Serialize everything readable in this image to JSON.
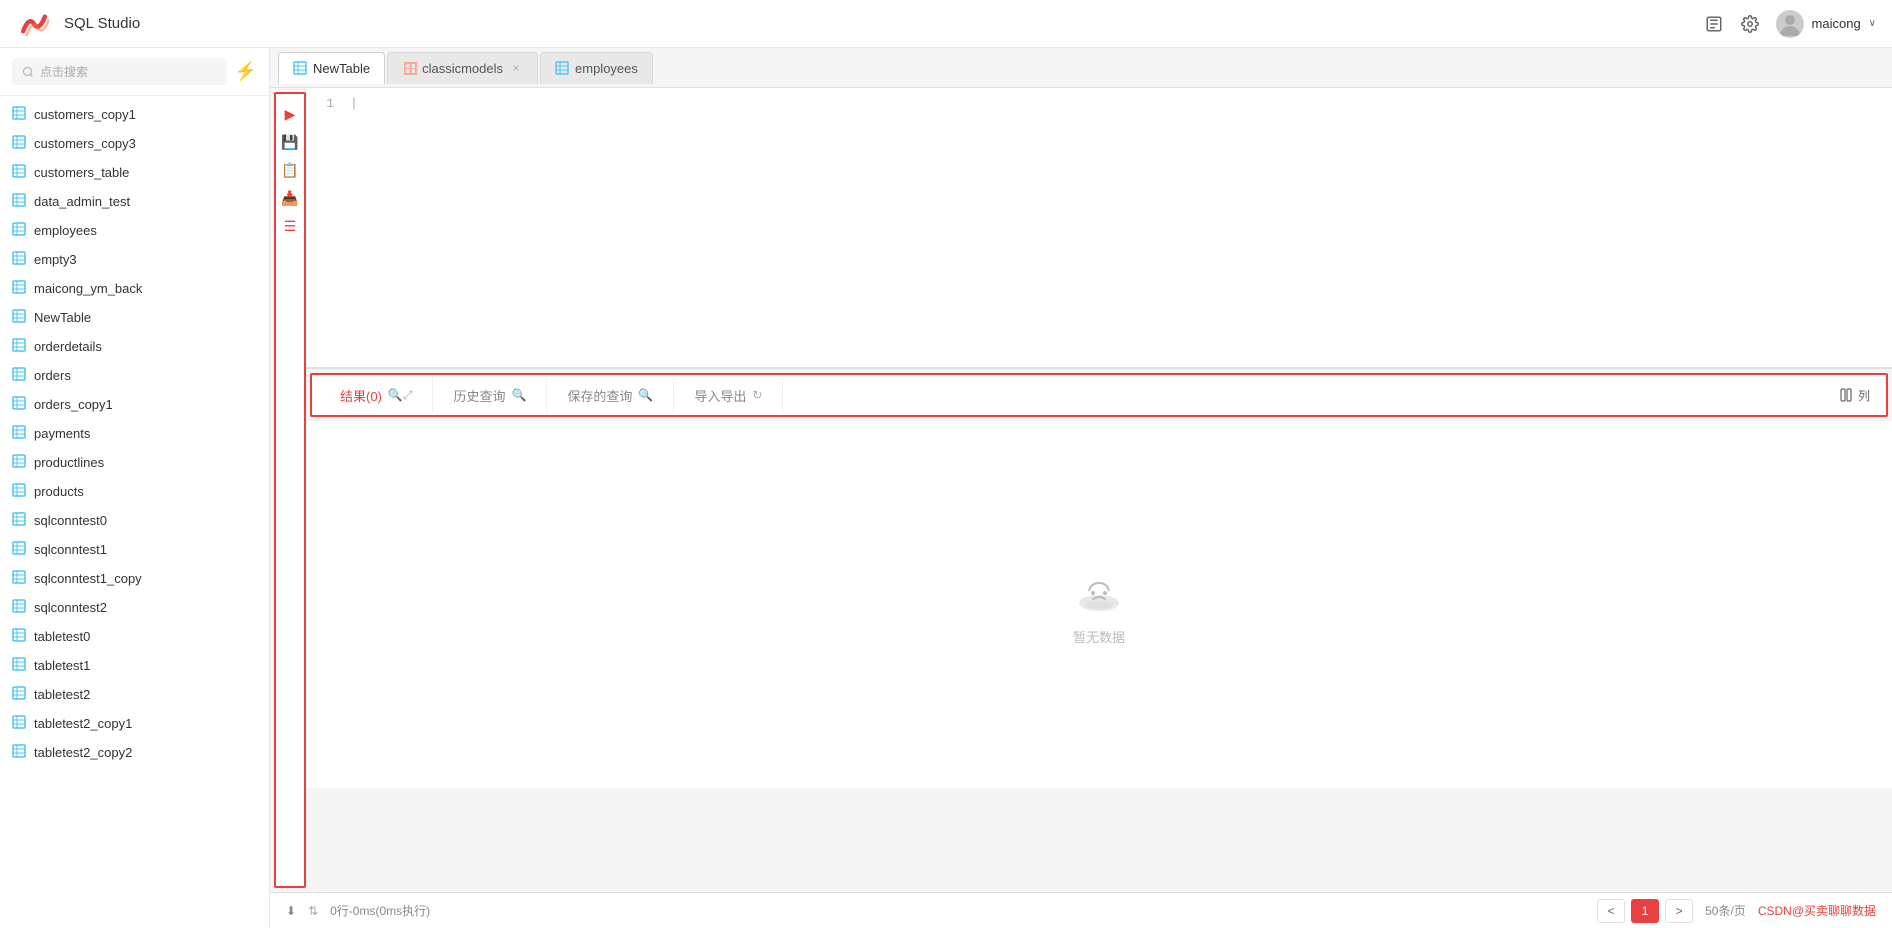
{
  "header": {
    "app_title": "SQL Studio",
    "username": "maicong",
    "chevron": "∨"
  },
  "sidebar": {
    "search_placeholder": "点击搜索",
    "items": [
      {
        "label": "customers_copy1"
      },
      {
        "label": "customers_copy3"
      },
      {
        "label": "customers_table"
      },
      {
        "label": "data_admin_test"
      },
      {
        "label": "employees"
      },
      {
        "label": "empty3"
      },
      {
        "label": "maicong_ym_back"
      },
      {
        "label": "NewTable"
      },
      {
        "label": "orderdetails"
      },
      {
        "label": "orders"
      },
      {
        "label": "orders_copy1"
      },
      {
        "label": "payments"
      },
      {
        "label": "productlines"
      },
      {
        "label": "products"
      },
      {
        "label": "sqlconntest0"
      },
      {
        "label": "sqlconntest1"
      },
      {
        "label": "sqlconntest1_copy"
      },
      {
        "label": "sqlconntest2"
      },
      {
        "label": "tabletest0"
      },
      {
        "label": "tabletest1"
      },
      {
        "label": "tabletest2"
      },
      {
        "label": "tabletest2_copy1"
      },
      {
        "label": "tabletest2_copy2"
      }
    ]
  },
  "tabs": [
    {
      "label": "NewTable",
      "icon_type": "table",
      "active": true
    },
    {
      "label": "classicmodels",
      "icon_type": "db",
      "active": false,
      "closable": true
    },
    {
      "label": "employees",
      "icon_type": "table",
      "active": false
    }
  ],
  "toolbar_buttons": [
    {
      "name": "run",
      "icon": "▶"
    },
    {
      "name": "save",
      "icon": "💾"
    },
    {
      "name": "format",
      "icon": "📋"
    },
    {
      "name": "download",
      "icon": "📥"
    },
    {
      "name": "menu",
      "icon": "☰"
    }
  ],
  "editor": {
    "line_number": "1"
  },
  "results": {
    "tabs": [
      {
        "label": "结果(0)",
        "icons": [
          "🔍",
          "⤢"
        ],
        "active": true
      },
      {
        "label": "历史查询",
        "icon": "🔍",
        "active": false
      },
      {
        "label": "保存的查询",
        "icon": "🔍",
        "active": false
      },
      {
        "label": "导入导出",
        "icon": "↻",
        "active": false
      }
    ],
    "col_button": "列",
    "empty_text": "暂无数据"
  },
  "bottom_bar": {
    "download_icon": "⬇",
    "sort_icon": "⇅",
    "stats": "0行-0ms(0ms执行)",
    "prev": "<",
    "next": ">",
    "page": "1",
    "page_size": "50条/页",
    "csdn_link": "CSDN@买卖聊聊数据"
  }
}
